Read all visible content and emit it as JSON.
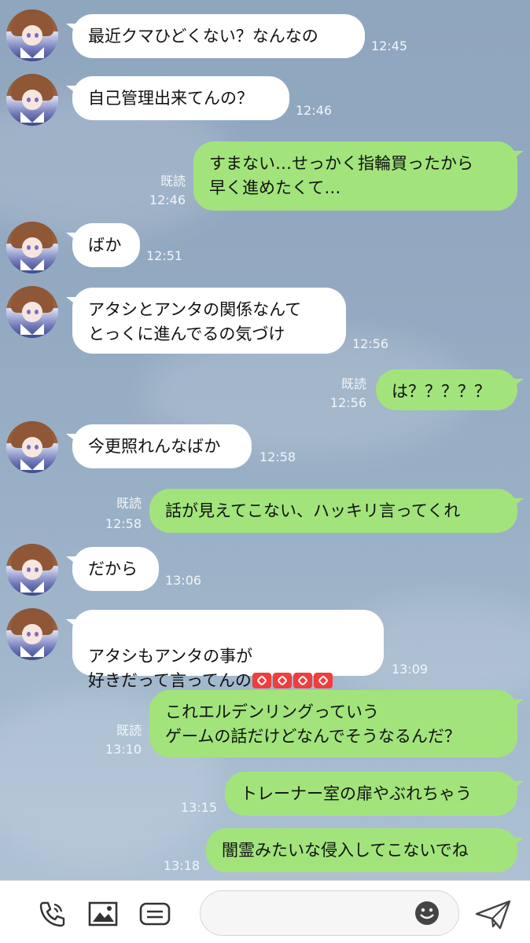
{
  "messages": [
    {
      "side": "in",
      "text": "最近クマひどくない？なんなの",
      "time": "12:45"
    },
    {
      "side": "in",
      "text": "自己管理出来てんの？",
      "time": "12:46"
    },
    {
      "side": "out",
      "text": "すまない…せっかく指輪買ったから\n早く進めたくて…",
      "read": "既読",
      "time": "12:46"
    },
    {
      "side": "in",
      "text": "ばか",
      "time": "12:51"
    },
    {
      "side": "in",
      "text": "アタシとアンタの関係なんて\nとっくに進んでるの気づけ",
      "time": "12:56"
    },
    {
      "side": "out",
      "text": "は？？？？？",
      "read": "既読",
      "time": "12:56"
    },
    {
      "side": "in",
      "text": "今更照れんなばか",
      "time": "12:58"
    },
    {
      "side": "out",
      "text": "話が見えてこない、ハッキリ言ってくれ",
      "read": "既読",
      "time": "12:58"
    },
    {
      "side": "in",
      "text": "だから",
      "time": "13:06"
    },
    {
      "side": "in",
      "text": "アタシもアンタの事が\n好きだって言ってんの",
      "emoji": "anger-symbol x4",
      "time": "13:09"
    },
    {
      "side": "out",
      "text": "これエルデンリングっていう\nゲームの話だけどなんでそうなるんだ？",
      "read": "既読",
      "time": "13:10"
    },
    {
      "side": "out",
      "text": "トレーナー室の扉やぶれちゃう",
      "time": "13:15"
    },
    {
      "side": "out",
      "text": "闇霊みたいな侵入してこないでね",
      "time": "13:18"
    }
  ],
  "toolbar": {
    "icons": [
      "phone-icon",
      "image-icon",
      "keep-icon",
      "emoji-icon",
      "send-icon"
    ],
    "input_placeholder": ""
  },
  "colors": {
    "incoming_bubble": "#ffffff",
    "outgoing_bubble": "#a2e47b",
    "background": "#93a9c1",
    "meta_text": "#f2f6fa",
    "toolbar": "#ffffff"
  }
}
